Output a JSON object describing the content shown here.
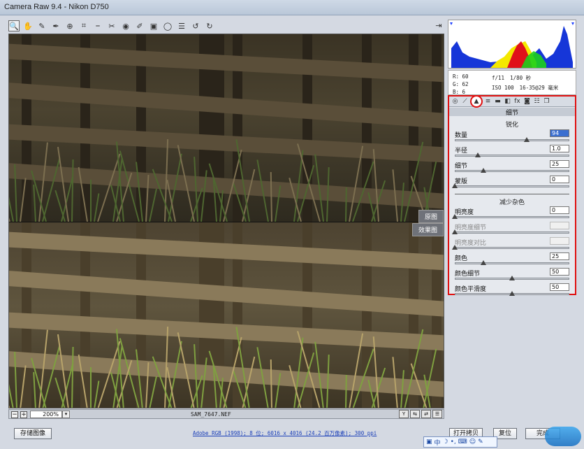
{
  "window": {
    "title": "Camera Raw 9.4 -  Nikon D750"
  },
  "toolbar": {
    "tools": [
      {
        "name": "zoom-tool",
        "icon": "🔍",
        "active": true
      },
      {
        "name": "hand-tool",
        "icon": "✋"
      },
      {
        "name": "white-balance-tool",
        "icon": "✎"
      },
      {
        "name": "color-sampler-tool",
        "icon": "✒"
      },
      {
        "name": "targeted-adjustment-tool",
        "icon": "⊕"
      },
      {
        "name": "crop-tool",
        "icon": "⌗"
      },
      {
        "name": "straighten-tool",
        "icon": "⎯"
      },
      {
        "name": "spot-removal-tool",
        "icon": "✂"
      },
      {
        "name": "red-eye-tool",
        "icon": "◉"
      },
      {
        "name": "adjustment-brush-tool",
        "icon": "✐"
      },
      {
        "name": "graduated-filter-tool",
        "icon": "▣"
      },
      {
        "name": "radial-filter-tool",
        "icon": "◯"
      },
      {
        "name": "preferences-tool",
        "icon": "☰"
      },
      {
        "name": "rotate-ccw-tool",
        "icon": "↺"
      },
      {
        "name": "rotate-cw-tool",
        "icon": "↻"
      }
    ],
    "export_icon": "⇥"
  },
  "preview": {
    "label_original": "原图",
    "label_after": "效果图"
  },
  "preview_status": {
    "zoom": "200%",
    "filename": "SAM_7647.NEF"
  },
  "info": {
    "r_label": "R:",
    "r": "60",
    "g_label": "G:",
    "g": "62",
    "b_label": "B:",
    "b": "6",
    "aperture": "f/11",
    "shutter": "1/80 秒",
    "iso": "ISO 100",
    "lens": "16-35@29 毫米"
  },
  "tabs": [
    {
      "name": "basic-tab",
      "icon": "◎"
    },
    {
      "name": "tone-curve-tab",
      "icon": "⟋"
    },
    {
      "name": "detail-tab",
      "icon": "▲",
      "active": true
    },
    {
      "name": "hsl-tab",
      "icon": "≡"
    },
    {
      "name": "split-toning-tab",
      "icon": "▬"
    },
    {
      "name": "lens-corrections-tab",
      "icon": "◧"
    },
    {
      "name": "effects-tab",
      "icon": "fx"
    },
    {
      "name": "camera-calibration-tab",
      "icon": "◙"
    },
    {
      "name": "presets-tab",
      "icon": "☷"
    },
    {
      "name": "snapshots-tab",
      "icon": "❐"
    }
  ],
  "panel": {
    "title": "细节",
    "sharpening": {
      "title": "锐化",
      "controls": [
        {
          "label": "数量",
          "value": "94",
          "selected": true,
          "level": 0.63
        },
        {
          "label": "半径",
          "value": "1.0",
          "level": 0.2
        },
        {
          "label": "细节",
          "value": "25",
          "level": 0.25
        },
        {
          "label": "蒙版",
          "value": "0",
          "level": 0.0
        }
      ]
    },
    "noise": {
      "title": "减少杂色",
      "controls": [
        {
          "label": "明亮度",
          "value": "0",
          "level": 0.0
        },
        {
          "label": "明亮度细节",
          "value": "",
          "disabled": true,
          "level": 0.0
        },
        {
          "label": "明亮度对比",
          "value": "",
          "disabled": true,
          "level": 0.0
        },
        {
          "label": "颜色",
          "value": "25",
          "level": 0.25
        },
        {
          "label": "颜色细节",
          "value": "50",
          "level": 0.5
        },
        {
          "label": "颜色平滑度",
          "value": "50",
          "level": 0.5
        }
      ]
    }
  },
  "bottom": {
    "save_label": "存储图像",
    "workflow": "Adobe RGB (1998); 8 位; 6016 x 4016 (24.2 百万像素); 300 ppi",
    "open_label": "打开拷贝",
    "reset_label": "复位",
    "done_label": "完成"
  },
  "ime": {
    "lang": "中"
  },
  "colors": {
    "highlight_red": "#e01010",
    "link_blue": "#1a3fb8"
  }
}
